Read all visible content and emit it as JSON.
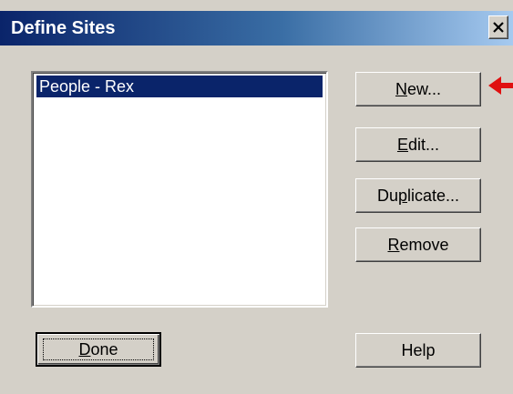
{
  "window": {
    "title": "Define Sites",
    "close_label": "Close"
  },
  "site_list": {
    "items": [
      {
        "label": "People - Rex",
        "selected": true
      }
    ]
  },
  "buttons": {
    "new": {
      "before": "",
      "mnemonic": "N",
      "after": "ew..."
    },
    "edit": {
      "before": "",
      "mnemonic": "E",
      "after": "dit..."
    },
    "duplicate": {
      "before": "Du",
      "mnemonic": "p",
      "after": "licate..."
    },
    "remove": {
      "before": "",
      "mnemonic": "R",
      "after": "emove"
    },
    "done": {
      "before": "",
      "mnemonic": "D",
      "after": "one"
    },
    "help": {
      "label": "Help"
    }
  },
  "annotation": {
    "arrow_color": "#e01010",
    "points_to": "new-button"
  },
  "colors": {
    "dialog_face": "#d4d0c8",
    "title_gradient_start": "#0a246a",
    "title_gradient_end": "#a6caf0",
    "selection": "#0a246a"
  }
}
